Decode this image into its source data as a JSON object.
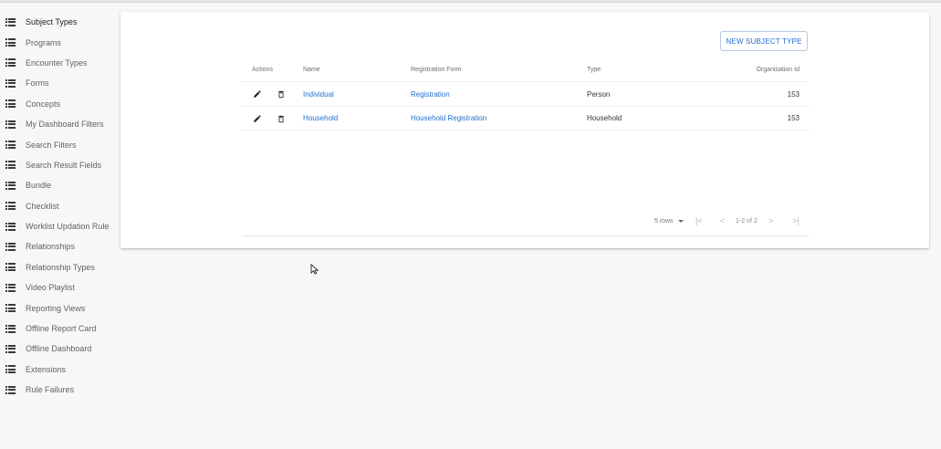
{
  "sidebar": {
    "items": [
      {
        "label": "Subject Types",
        "icon": "list-icon"
      },
      {
        "label": "Programs",
        "icon": "list-icon"
      },
      {
        "label": "Encounter Types",
        "icon": "list-icon"
      },
      {
        "label": "Forms",
        "icon": "list-icon"
      },
      {
        "label": "Concepts",
        "icon": "list-icon"
      },
      {
        "label": "My Dashboard Filters",
        "icon": "list-icon"
      },
      {
        "label": "Search Filters",
        "icon": "list-icon"
      },
      {
        "label": "Search Result Fields",
        "icon": "list-icon"
      },
      {
        "label": "Bundle",
        "icon": "list-icon"
      },
      {
        "label": "Checklist",
        "icon": "list-icon"
      },
      {
        "label": "Worklist Updation Rule",
        "icon": "list-icon"
      },
      {
        "label": "Relationships",
        "icon": "list-icon"
      },
      {
        "label": "Relationship Types",
        "icon": "list-icon"
      },
      {
        "label": "Video Playlist",
        "icon": "list-icon"
      },
      {
        "label": "Reporting Views",
        "icon": "list-icon"
      },
      {
        "label": "Offline Report Card",
        "icon": "list-icon"
      },
      {
        "label": "Offline Dashboard",
        "icon": "list-icon"
      },
      {
        "label": "Extensions",
        "icon": "list-icon"
      },
      {
        "label": "Rule Failures",
        "icon": "list-icon"
      }
    ]
  },
  "toolbar": {
    "new_label": "NEW SUBJECT TYPE"
  },
  "table": {
    "headers": {
      "actions": "Actions",
      "name": "Name",
      "form": "Registration Form",
      "type": "Type",
      "org": "Organisation Id"
    },
    "rows": [
      {
        "name": "Individual",
        "form": "Registration",
        "type": "Person",
        "org": "153"
      },
      {
        "name": "Household",
        "form": "Household Registration",
        "type": "Household",
        "org": "153"
      }
    ]
  },
  "pagination": {
    "rows_label": "5 rows",
    "range": "1-2 of 2",
    "first": "|<",
    "prev": "<",
    "next": ">",
    "last": ">|"
  },
  "colors": {
    "link": "#1f6fd1",
    "background": "#f7f7f7"
  }
}
